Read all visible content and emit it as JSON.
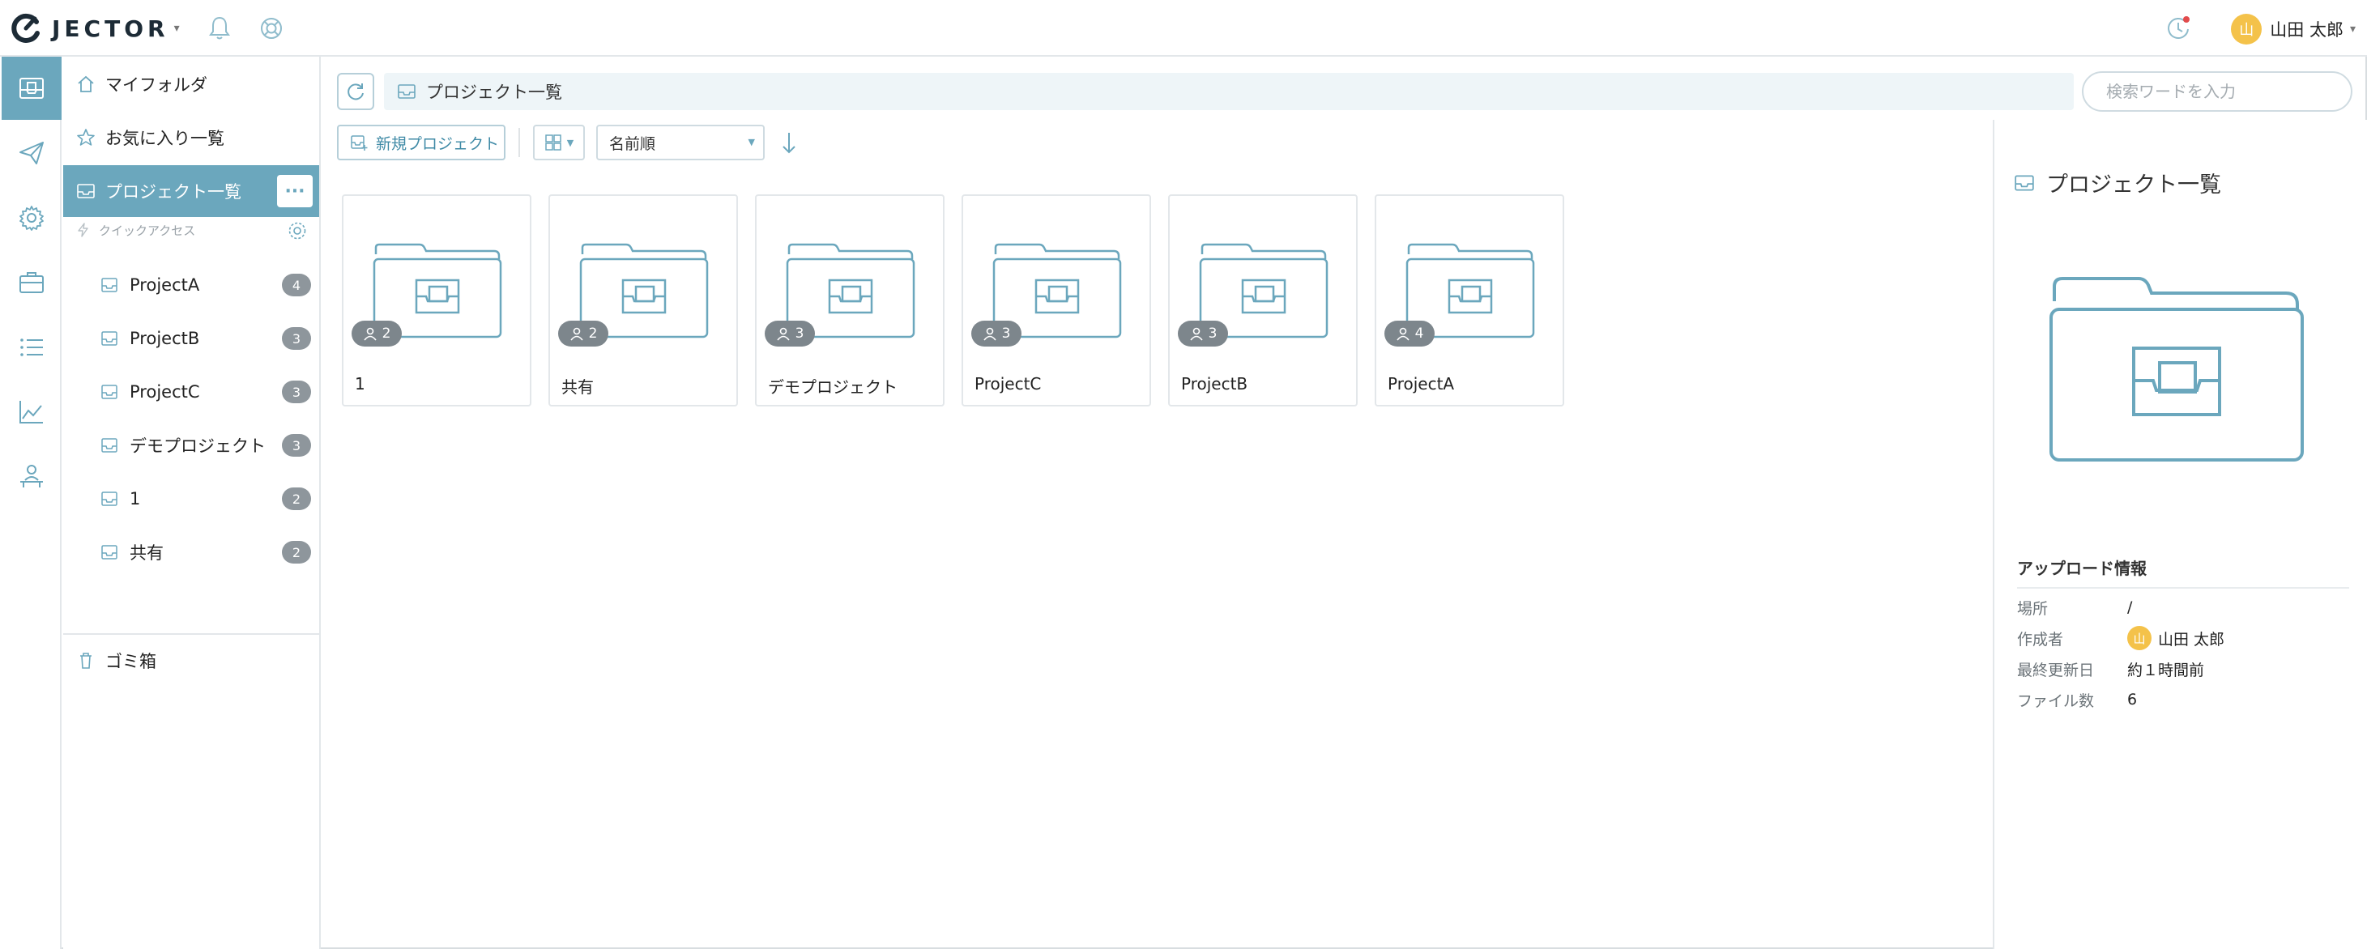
{
  "app": {
    "logo_text": "JECTOR"
  },
  "topbar": {
    "icons": [
      "notification-bell-icon",
      "help-lifebuoy-icon",
      "activity-clock-icon"
    ],
    "user": {
      "avatar_initial": "山",
      "name": "山田 太郎"
    }
  },
  "rail": {
    "items": [
      "inbox-icon",
      "send-icon",
      "settings-icon",
      "briefcase-icon",
      "list-icon",
      "chart-icon",
      "org-icon"
    ],
    "active": "inbox-icon"
  },
  "sidebar": {
    "my_folder": "マイフォルダ",
    "favorites": "お気に入り一覧",
    "projects": "プロジェクト一覧",
    "more_label": "···",
    "quick_access_label": "クイックアクセス",
    "quick_items": [
      {
        "label": "ProjectA",
        "count": "4"
      },
      {
        "label": "ProjectB",
        "count": "3"
      },
      {
        "label": "ProjectC",
        "count": "3"
      },
      {
        "label": "デモプロジェクト",
        "count": "3"
      },
      {
        "label": "1",
        "count": "2"
      },
      {
        "label": "共有",
        "count": "2"
      }
    ],
    "trash": "ゴミ箱"
  },
  "main": {
    "breadcrumb": "プロジェクト一覧",
    "search_placeholder": "検索ワードを入力",
    "new_project_label": "新規プロジェクト",
    "sort_label": "名前順",
    "cards": [
      {
        "name": "1",
        "members": "2"
      },
      {
        "name": "共有",
        "members": "2"
      },
      {
        "name": "デモプロジェクト",
        "members": "3"
      },
      {
        "name": "ProjectC",
        "members": "3"
      },
      {
        "name": "ProjectB",
        "members": "3"
      },
      {
        "name": "ProjectA",
        "members": "4"
      }
    ]
  },
  "panel": {
    "title": "プロジェクト一覧",
    "section_title": "アップロード情報",
    "rows": [
      {
        "label": "場所",
        "value": "/"
      },
      {
        "label": "作成者",
        "value": "山田 太郎",
        "avatar_initial": "山"
      },
      {
        "label": "最終更新日",
        "value": "約１時間前"
      },
      {
        "label": "ファイル数",
        "value": "6"
      }
    ]
  },
  "colors": {
    "accent": "#6ba7bd",
    "badge": "#8e969c",
    "avatar": "#f4c24a"
  }
}
